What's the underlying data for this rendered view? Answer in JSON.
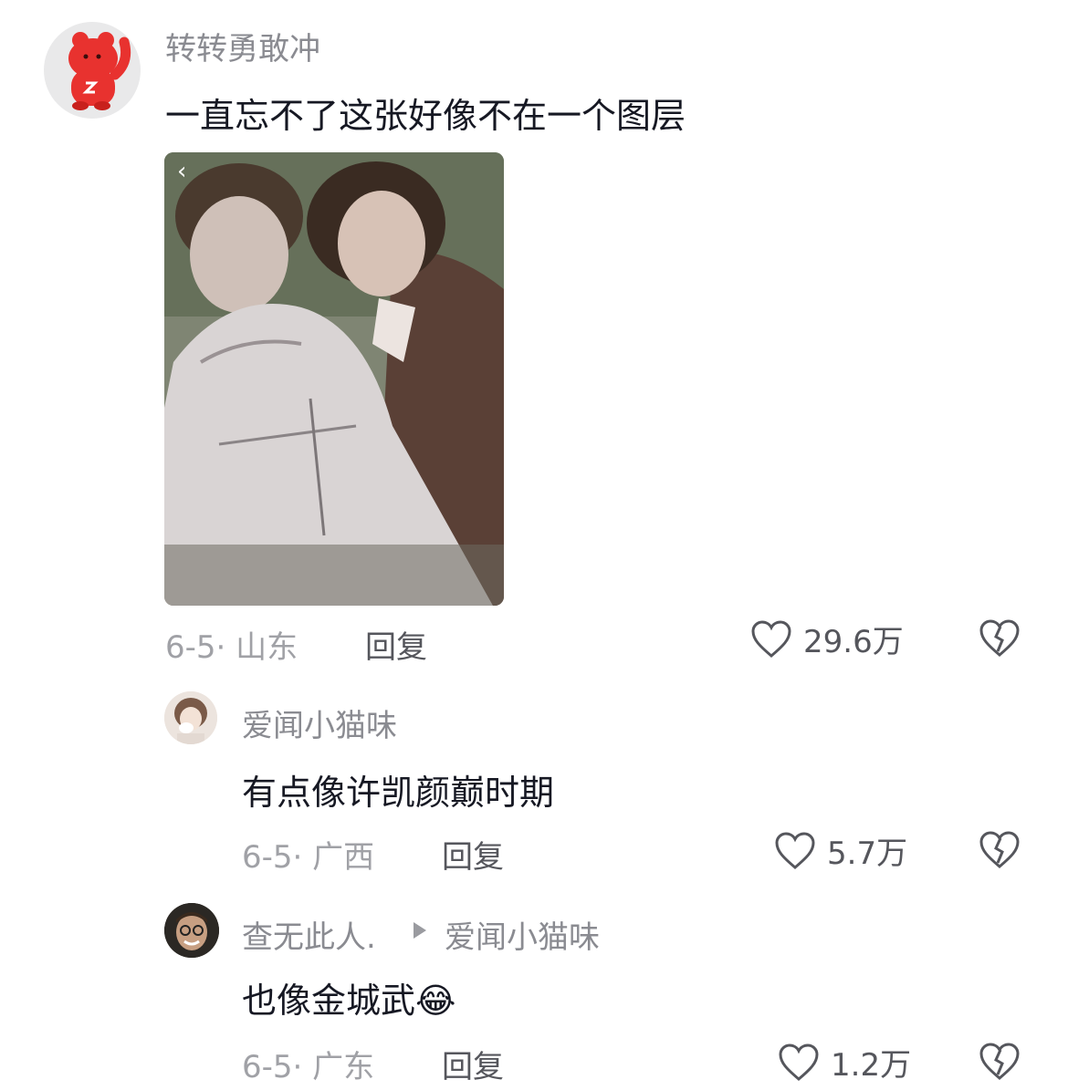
{
  "comments": [
    {
      "username": "转转勇敢冲",
      "text": "一直忘不了这张好像不在一个图层",
      "date_region": "6-5· 山东",
      "reply_label": "回复",
      "likes": "29.6万",
      "has_image": true
    },
    {
      "username": "爱闻小猫味",
      "text": "有点像许凯颜巅时期",
      "date_region": "6-5· 广西",
      "reply_label": "回复",
      "likes": "5.7万"
    },
    {
      "username": "查无此人.",
      "reply_to": "爱闻小猫味",
      "text": "也像金城武",
      "emoji": "😂",
      "date_region": "6-5· 广东",
      "reply_label": "回复",
      "likes": "1.2万"
    }
  ],
  "colors": {
    "avatar_bear": "#e8322f",
    "avatar_bg": "#e9e9ea",
    "text_primary": "#161823",
    "text_secondary": "#8a8b91",
    "icon_gray": "#55565c"
  }
}
